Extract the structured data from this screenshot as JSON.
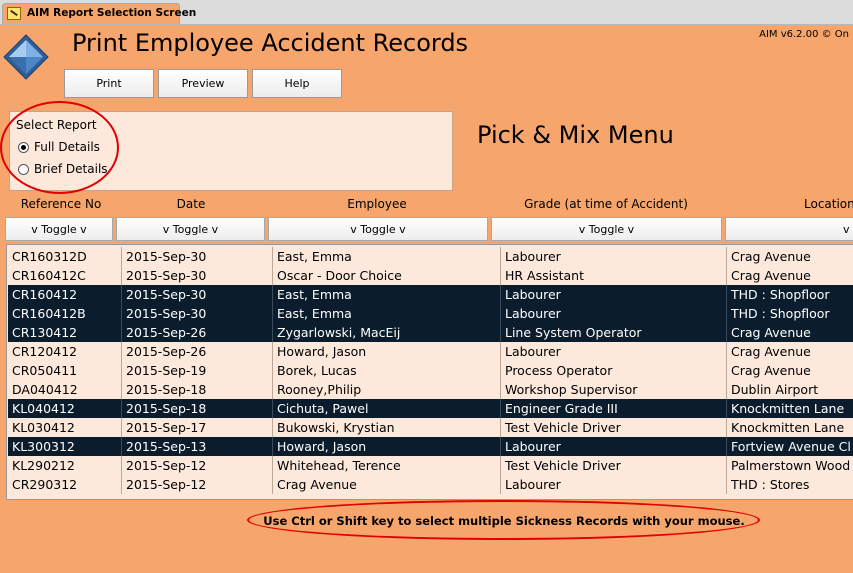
{
  "window": {
    "tab_title": "AIM Report Selection Screen",
    "version": "AIM v6.2.00 © On"
  },
  "header": {
    "title": "Print Employee Accident Records",
    "logo_icon": "aim-diamond-logo-icon"
  },
  "toolbar": {
    "print_label": "Print",
    "preview_label": "Preview",
    "help_label": "Help"
  },
  "report": {
    "label": "Select Report",
    "options": [
      {
        "label": "Full Details",
        "selected": true
      },
      {
        "label": "Brief Details",
        "selected": false
      }
    ]
  },
  "menu": {
    "title": "Pick & Mix Menu"
  },
  "columns": [
    {
      "header": "Reference No",
      "toggle": "v Toggle v"
    },
    {
      "header": "Date",
      "toggle": "v Toggle v"
    },
    {
      "header": "Employee",
      "toggle": "v Toggle v"
    },
    {
      "header": "Grade (at time of Accident)",
      "toggle": "v Toggle v"
    },
    {
      "header": "Location",
      "toggle": "v Toggle v"
    }
  ],
  "rows": [
    {
      "ref": "CR160312D",
      "date": "2015-Sep-30",
      "employee": "East, Emma",
      "grade": "Labourer",
      "location": "Crag Avenue",
      "selected": false
    },
    {
      "ref": "CR160412C",
      "date": "2015-Sep-30",
      "employee": "Oscar - Door Choice",
      "grade": "HR Assistant",
      "location": "Crag Avenue",
      "selected": false
    },
    {
      "ref": "CR160412",
      "date": "2015-Sep-30",
      "employee": "East, Emma",
      "grade": "Labourer",
      "location": "THD : Shopfloor",
      "selected": true
    },
    {
      "ref": "CR160412B",
      "date": "2015-Sep-30",
      "employee": "East, Emma",
      "grade": "Labourer",
      "location": "THD : Shopfloor",
      "selected": true
    },
    {
      "ref": "CR130412",
      "date": "2015-Sep-26",
      "employee": "Zygarlowski, MacEij",
      "grade": "Line System Operator",
      "location": "Crag Avenue",
      "selected": true
    },
    {
      "ref": "CR120412",
      "date": "2015-Sep-26",
      "employee": "Howard, Jason",
      "grade": "Labourer",
      "location": "Crag Avenue",
      "selected": false
    },
    {
      "ref": "CR050411",
      "date": "2015-Sep-19",
      "employee": "Borek, Lucas",
      "grade": "Process Operator",
      "location": "Crag Avenue",
      "selected": false
    },
    {
      "ref": "DA040412",
      "date": "2015-Sep-18",
      "employee": "Rooney,Philip",
      "grade": "Workshop Supervisor",
      "location": "Dublin Airport",
      "selected": false
    },
    {
      "ref": "KL040412",
      "date": "2015-Sep-18",
      "employee": "Cichuta, Pawel",
      "grade": "Engineer Grade III",
      "location": "Knockmitten Lane",
      "selected": true
    },
    {
      "ref": "KL030412",
      "date": "2015-Sep-17",
      "employee": "Bukowski, Krystian",
      "grade": "Test Vehicle Driver",
      "location": "Knockmitten Lane",
      "selected": false
    },
    {
      "ref": "KL300312",
      "date": "2015-Sep-13",
      "employee": "Howard, Jason",
      "grade": "Labourer",
      "location": "Fortview Avenue Cl",
      "selected": true
    },
    {
      "ref": "KL290212",
      "date": "2015-Sep-12",
      "employee": "Whitehead, Terence",
      "grade": "Test Vehicle Driver",
      "location": "Palmerstown Wood",
      "selected": false
    },
    {
      "ref": "CR290312",
      "date": "2015-Sep-12",
      "employee": "Crag Avenue",
      "grade": "Labourer",
      "location": "THD : Stores",
      "selected": false
    }
  ],
  "footer": {
    "hint": "Use Ctrl or Shift key to select multiple Sickness Records with your mouse."
  },
  "colors": {
    "background": "#F6A66C",
    "panel": "#FDE9DB",
    "selected_row": "#0B1C2C",
    "annotation_ring": "#E00000"
  }
}
